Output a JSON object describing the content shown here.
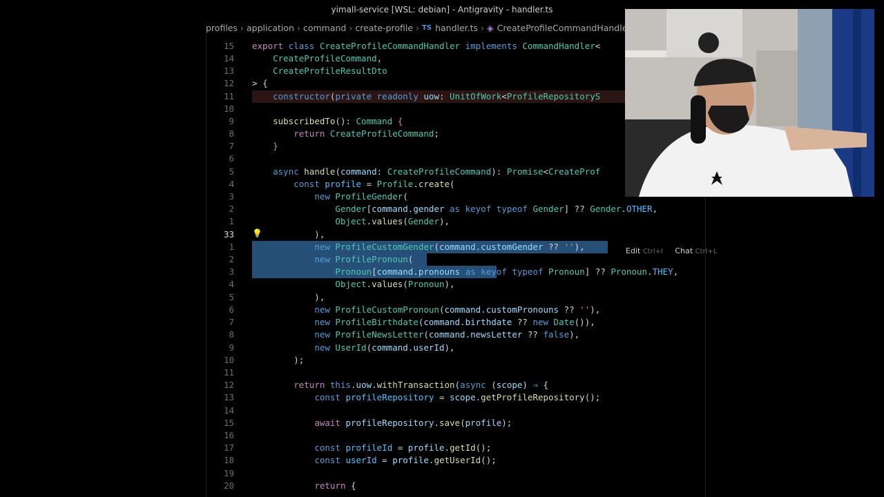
{
  "window": {
    "title": "yimall-service [WSL: debian] - Antigravity - handler.ts"
  },
  "breadcrumb": {
    "parts": [
      "profiles",
      "application",
      "command",
      "create-profile"
    ],
    "file_icon": "TS",
    "file": "handler.ts",
    "symbol": "CreateProfileCommandHandler"
  },
  "editor": {
    "line_numbers": [
      "15",
      "14",
      "13",
      "12",
      "11",
      "10",
      "9",
      "8",
      "7",
      "6",
      "5",
      "4",
      "3",
      "2",
      "1",
      "33",
      "1",
      "2",
      "3",
      "4",
      "5",
      "6",
      "7",
      "8",
      "9",
      "10",
      "11",
      "12",
      "13",
      "14",
      "15",
      "16",
      "17",
      "18",
      "19",
      "20"
    ],
    "inline_hint": {
      "edit": "Edit",
      "edit_shortcut": "Ctrl+I",
      "chat": "Chat",
      "chat_shortcut": "Ctrl+L"
    }
  },
  "webcam": {
    "description_icon": "webcam-overlay-person"
  }
}
